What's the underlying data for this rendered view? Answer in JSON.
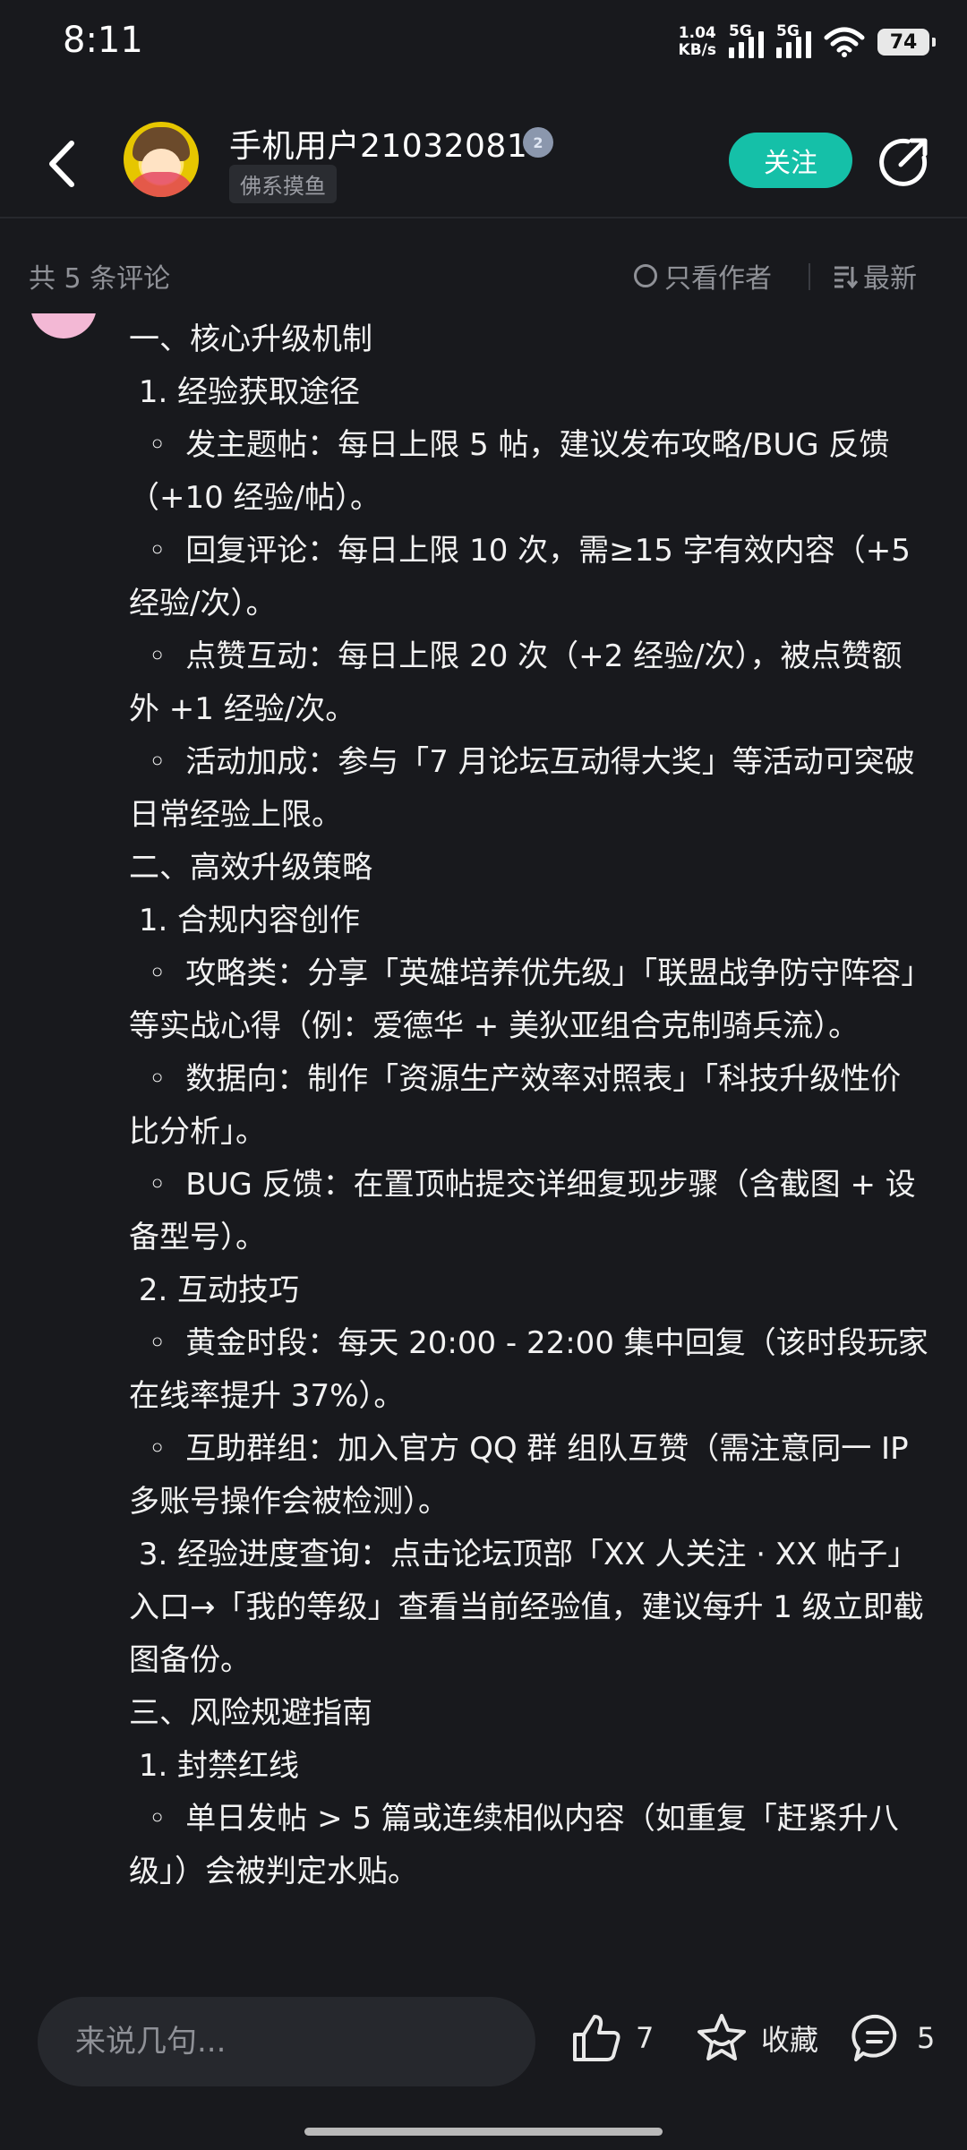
{
  "status_bar": {
    "time": "8:11",
    "net_speed_value": "1.04",
    "net_speed_unit": "KB/s",
    "sim1": "5G",
    "sim2": "5G",
    "battery": "74"
  },
  "header": {
    "username": "手机用户21032081",
    "level_badge": "2",
    "tag": "佛系摸鱼",
    "follow_label": "关注"
  },
  "comment_bar": {
    "count_label": "共 5 条评论",
    "author_only_label": "只看作者",
    "sort_label": "最新"
  },
  "post": {
    "lines": [
      "一、核心升级机制",
      " 1. 经验获取途径",
      "  ◦  发主题帖：每日上限 5 帖，建议发布攻略/BUG 反馈（+10 经验/帖）。",
      "  ◦  回复评论：每日上限 10 次，需≥15 字有效内容（+5 经验/次）。",
      "  ◦  点赞互动：每日上限 20 次（+2 经验/次），被点赞额外 +1 经验/次。",
      "  ◦  活动加成：参与「7 月论坛互动得大奖」等活动可突破日常经验上限。",
      "二、高效升级策略",
      " 1. 合规内容创作",
      "  ◦  攻略类：分享「英雄培养优先级」「联盟战争防守阵容」等实战心得（例：爱德华 + 美狄亚组合克制骑兵流）。",
      "  ◦  数据向：制作「资源生产效率对照表」「科技升级性价比分析」。",
      "  ◦  BUG 反馈：在置顶帖提交详细复现步骤（含截图 + 设备型号）。",
      " 2. 互动技巧",
      "  ◦  黄金时段：每天 20:00 - 22:00 集中回复（该时段玩家在线率提升 37%）。",
      "  ◦  互助群组：加入官方 QQ 群 组队互赞（需注意同一 IP 多账号操作会被检测）。",
      " 3. 经验进度查询：点击论坛顶部「XX 人关注 · XX 帖子」入口→「我的等级」查看当前经验值，建议每升 1 级立即截图备份。",
      "三、风险规避指南",
      " 1. 封禁红线",
      "  ◦  单日发帖 > 5 篇或连续相似内容（如重复「赶紧升八级」）会被判定水贴。"
    ]
  },
  "bottom": {
    "input_placeholder": "来说几句...",
    "like_count": "7",
    "favorite_label": "收藏",
    "comment_count": "5"
  }
}
